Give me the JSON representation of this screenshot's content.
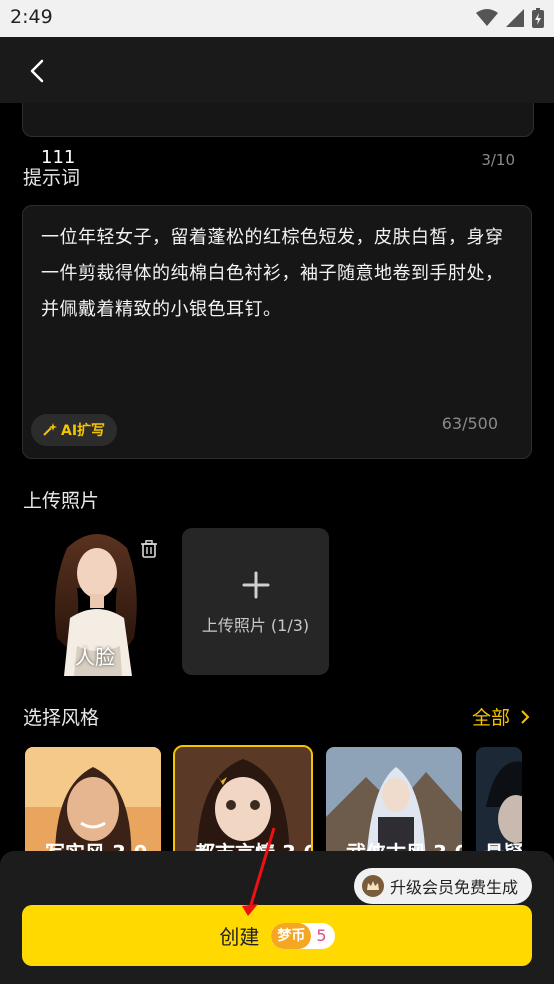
{
  "status_bar": {
    "time": "2:49"
  },
  "title_field": {
    "value": "111",
    "count": "3/10"
  },
  "prompt": {
    "label": "提示词",
    "text": "一位年轻女子，留着蓬松的红棕色短发，皮肤白皙，身穿一件剪裁得体的纯棉白色衬衫，袖子随意地卷到手肘处，并佩戴着精致的小银色耳钉。",
    "count": "63/500",
    "ai_expand_label": "AI扩写"
  },
  "upload": {
    "label": "上传照片",
    "photo_caption": "人脸",
    "tile_label": "上传照片 (1/3)"
  },
  "styles": {
    "label": "选择风格",
    "all_label": "全部",
    "items": [
      {
        "name": "写实风 3.0"
      },
      {
        "name": "都市言情 3.0"
      },
      {
        "name": "武侠古风 3.0"
      },
      {
        "name": "悬疑"
      }
    ]
  },
  "bottom": {
    "vip_tip": "升级会员免费生成",
    "create_label": "创建",
    "coin_label": "梦币",
    "coin_cost": "5"
  },
  "colors": {
    "accent": "#ffd900",
    "background": "#000000",
    "card": "#161616"
  }
}
